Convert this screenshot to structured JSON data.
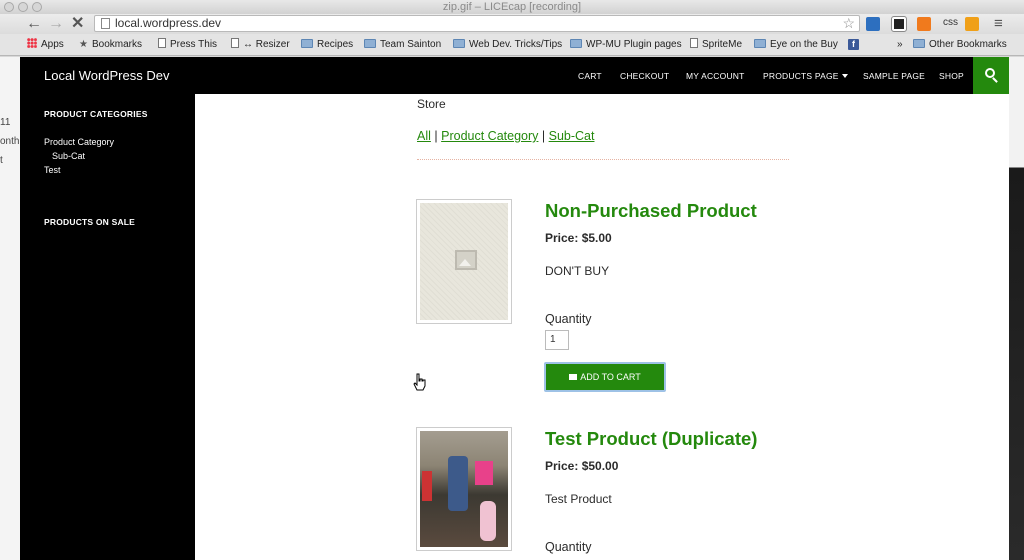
{
  "window": {
    "title": "zip.gif – LICEcap [recording]"
  },
  "browser": {
    "url": "local.wordpress.dev",
    "ext_css_label": "css",
    "bookmarks": [
      {
        "label": "Apps",
        "icon": "apps-grid-icon"
      },
      {
        "label": "Bookmarks",
        "icon": "star-icon"
      },
      {
        "label": "Press This",
        "icon": "page-icon"
      },
      {
        "label": "↔ Resizer",
        "icon": "page-icon"
      },
      {
        "label": "Recipes",
        "icon": "folder-icon"
      },
      {
        "label": "Team Sainton",
        "icon": "folder-icon"
      },
      {
        "label": "Web Dev. Tricks/Tips",
        "icon": "folder-icon"
      },
      {
        "label": "WP-MU Plugin pages",
        "icon": "folder-icon"
      },
      {
        "label": "SpriteMe",
        "icon": "page-icon"
      },
      {
        "label": "Eye on the Buy",
        "icon": "folder-icon"
      },
      {
        "label": "",
        "icon": "facebook-icon"
      }
    ],
    "overflow_label": "»",
    "other_bookmarks": "Other Bookmarks"
  },
  "background_window_text": [
    "11",
    "onth",
    "t"
  ],
  "site": {
    "title": "Local WordPress Dev",
    "menu": [
      {
        "label": "CART"
      },
      {
        "label": "CHECKOUT"
      },
      {
        "label": "MY ACCOUNT"
      },
      {
        "label": "PRODUCTS PAGE"
      },
      {
        "label": "SAMPLE PAGE"
      },
      {
        "label": "SHOP"
      }
    ],
    "accent_color": "#24890d"
  },
  "sidebar": {
    "categories_title": "PRODUCT CATEGORIES",
    "categories": [
      "Product Category",
      "Sub-Cat",
      "Test"
    ],
    "sale_title": "PRODUCTS ON SALE"
  },
  "main": {
    "heading": "Store",
    "filters": [
      "All",
      "Product Category",
      "Sub-Cat"
    ],
    "filter_separator": "|",
    "products": [
      {
        "name": "Non-Purchased Product",
        "price_label": "Price:",
        "price": "$5.00",
        "description": "DON'T BUY",
        "quantity_label": "Quantity",
        "quantity": "1",
        "button_label": "ADD TO CART"
      },
      {
        "name": "Test Product (Duplicate)",
        "price_label": "Price:",
        "price": "$50.00",
        "description": "Test Product",
        "quantity_label": "Quantity"
      }
    ]
  }
}
